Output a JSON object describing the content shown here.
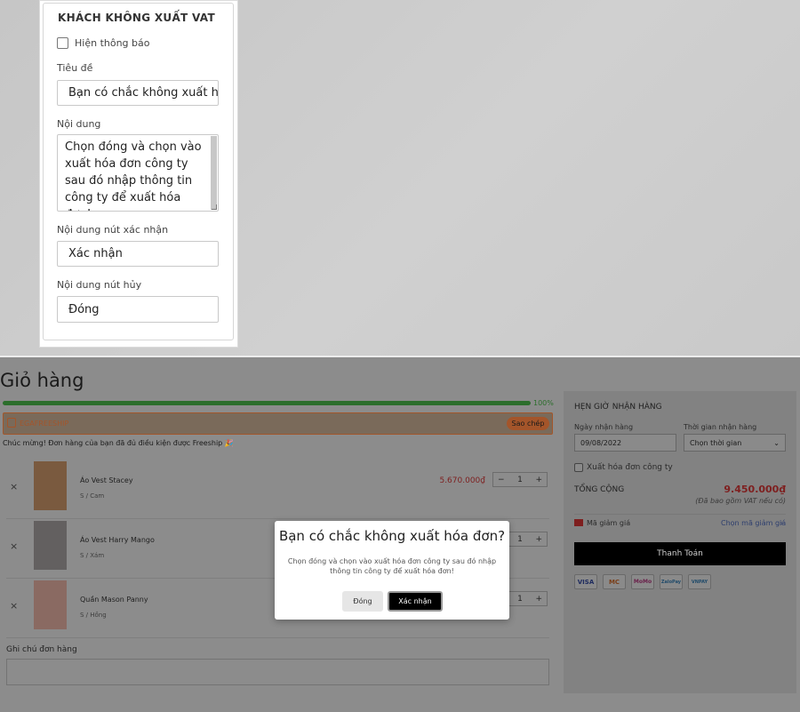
{
  "settings": {
    "heading": "KHÁCH KHÔNG XUẤT VAT",
    "show_label": "Hiện thông báo",
    "title_label": "Tiêu đề",
    "title_value": "Bạn có chắc không xuất hóa đơn?",
    "content_label": "Nội dung",
    "content_value": "Chọn đóng và chọn vào xuất hóa đơn công ty sau đó nhập thông tin công ty để xuất hóa đơn!",
    "confirm_label": "Nội dung nút xác nhận",
    "confirm_value": "Xác nhận",
    "cancel_label": "Nội dung nút hủy",
    "cancel_value": "Đóng"
  },
  "cart": {
    "title": "Giỏ hàng",
    "progress_label": "100%",
    "progress": 1.0,
    "freeship_code": "EGAFREESHIP",
    "copy_button": "Sao chép",
    "congrats": "Chúc mừng! Đơn hàng của bạn đã đủ điều kiện được Freeship 🎉",
    "items": [
      {
        "name": "Áo Vest Stacey",
        "variant": "S / Cam",
        "price": "5.670.000₫",
        "qty": "1"
      },
      {
        "name": "Áo Vest Harry Mango",
        "variant": "S / Xám",
        "price": "",
        "qty": "1"
      },
      {
        "name": "Quần Mason Panny",
        "variant": "S / Hồng",
        "price": "",
        "qty": "1"
      }
    ],
    "qty_minus": "−",
    "qty_plus": "+",
    "remove": "×",
    "note_label": "Ghi chú đơn hàng"
  },
  "sidebar": {
    "heading": "HẸN GIỜ NHẬN HÀNG",
    "date_label": "Ngày nhận hàng",
    "date_value": "09/08/2022",
    "time_label": "Thời gian nhận hàng",
    "time_value": "Chọn thời gian",
    "invoice_label": "Xuất hóa đơn công ty",
    "total_label": "TỔNG CỘNG",
    "total_value": "9.450.000₫",
    "vat_note": "(Đã bao gồm VAT nếu có)",
    "discount_label": "Mã giảm giá",
    "discount_link": "Chọn mã giảm giá",
    "checkout": "Thanh Toán",
    "payments": [
      "VISA",
      "MC",
      "MoMo",
      "ZaloPay",
      "VNPAY"
    ]
  },
  "modal": {
    "title": "Bạn có chắc không xuất hóa đơn?",
    "content": "Chọn đóng và chọn vào xuất hóa đơn công ty sau đó nhập thông tin công ty để xuất hóa đơn!",
    "cancel": "Đóng",
    "confirm": "Xác nhận"
  },
  "colors": {
    "accent": "#a4552a",
    "price": "#7e1f1f",
    "progress": "#2c6e2c",
    "dark": "#000000"
  }
}
